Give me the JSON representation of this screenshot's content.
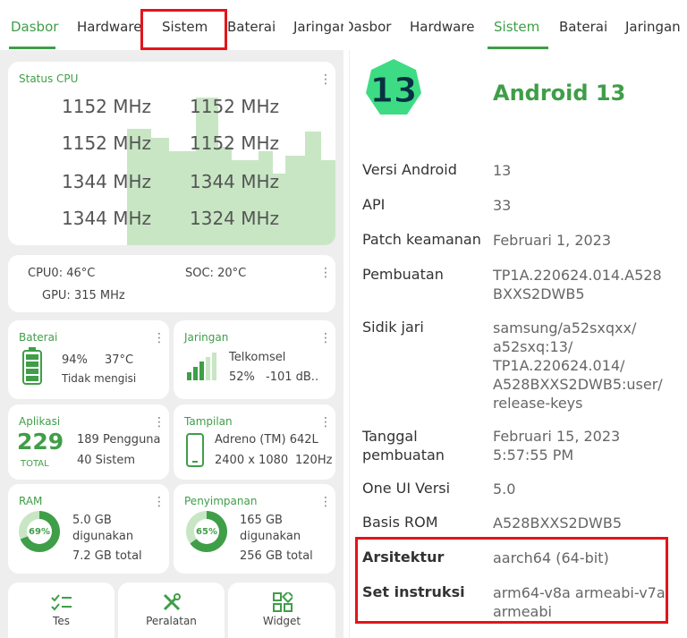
{
  "left_tabs": [
    "Dasbor",
    "Hardware",
    "Sistem",
    "Baterai",
    "Jaringan"
  ],
  "right_tabs": [
    "Dasbor",
    "Hardware",
    "Sistem",
    "Baterai",
    "Jaringan"
  ],
  "cpu": {
    "title": "Status CPU",
    "freqs": [
      "1152 MHz",
      "1152 MHz",
      "1152 MHz",
      "1152 MHz",
      "1344 MHz",
      "1344 MHz",
      "1344 MHz",
      "1324 MHz"
    ]
  },
  "temps": {
    "cpu0": "CPU0: 46°C",
    "soc": "SOC: 20°C",
    "gpu": "GPU: 315 MHz"
  },
  "battery": {
    "title": "Baterai",
    "percent": "94%",
    "temp": "37°C",
    "status": "Tidak mengisi",
    "level": 94
  },
  "network": {
    "title": "Jaringan",
    "carrier": "Telkomsel",
    "percent": "52%",
    "dbm": "-101 dB..",
    "signal_level": 52
  },
  "apps": {
    "title": "Aplikasi",
    "total": "229",
    "total_label": "TOTAL",
    "users": "189 Pengguna",
    "system": "40 Sistem"
  },
  "display": {
    "title": "Tampilan",
    "gpu": "Adreno (TM) 642L",
    "resolution": "2400 x 1080",
    "refresh": "120Hz"
  },
  "ram": {
    "title": "RAM",
    "percent": "69%",
    "used": "5.0 GB",
    "used_label": "digunakan",
    "total": "7.2 GB total",
    "fraction": 0.69
  },
  "storage": {
    "title": "Penyimpanan",
    "percent": "65%",
    "used": "165 GB",
    "used_label": "digunakan",
    "total": "256 GB total",
    "fraction": 0.65
  },
  "tools": [
    {
      "label": "Tes",
      "icon": "checklist-icon"
    },
    {
      "label": "Peralatan",
      "icon": "tools-icon"
    },
    {
      "label": "Widget",
      "icon": "widget-icon"
    }
  ],
  "system": {
    "android_badge": "13",
    "android_title": "Android 13",
    "rows": [
      {
        "label": "Versi Android",
        "value": "13"
      },
      {
        "label": "API",
        "value": "33"
      },
      {
        "label": "Patch keamanan",
        "value": "Februari 1, 2023"
      },
      {
        "label": "Pembuatan",
        "value": "TP1A.220624.014.A528 BXXS2DWB5"
      },
      {
        "label": "Sidik jari",
        "value": "samsung/a52sxqxx/ a52sxq:13/ TP1A.220624.014/ A528BXXS2DWB5:user/ release-keys"
      },
      {
        "label": "Tanggal pembuatan",
        "value": "Februari 15, 2023 5:57:55 PM"
      },
      {
        "label": "One UI Versi",
        "value": "5.0"
      },
      {
        "label": "Basis ROM",
        "value": "A528BXXS2DWB5"
      },
      {
        "label": "Arsitektur",
        "value": "aarch64 (64-bit)"
      },
      {
        "label": "Set instruksi",
        "value": "arm64-v8a armeabi-v7a armeabi"
      }
    ]
  },
  "colors": {
    "accent": "#3f9e48",
    "highlight": "#e2151b",
    "graph": "#c8e6c4"
  }
}
